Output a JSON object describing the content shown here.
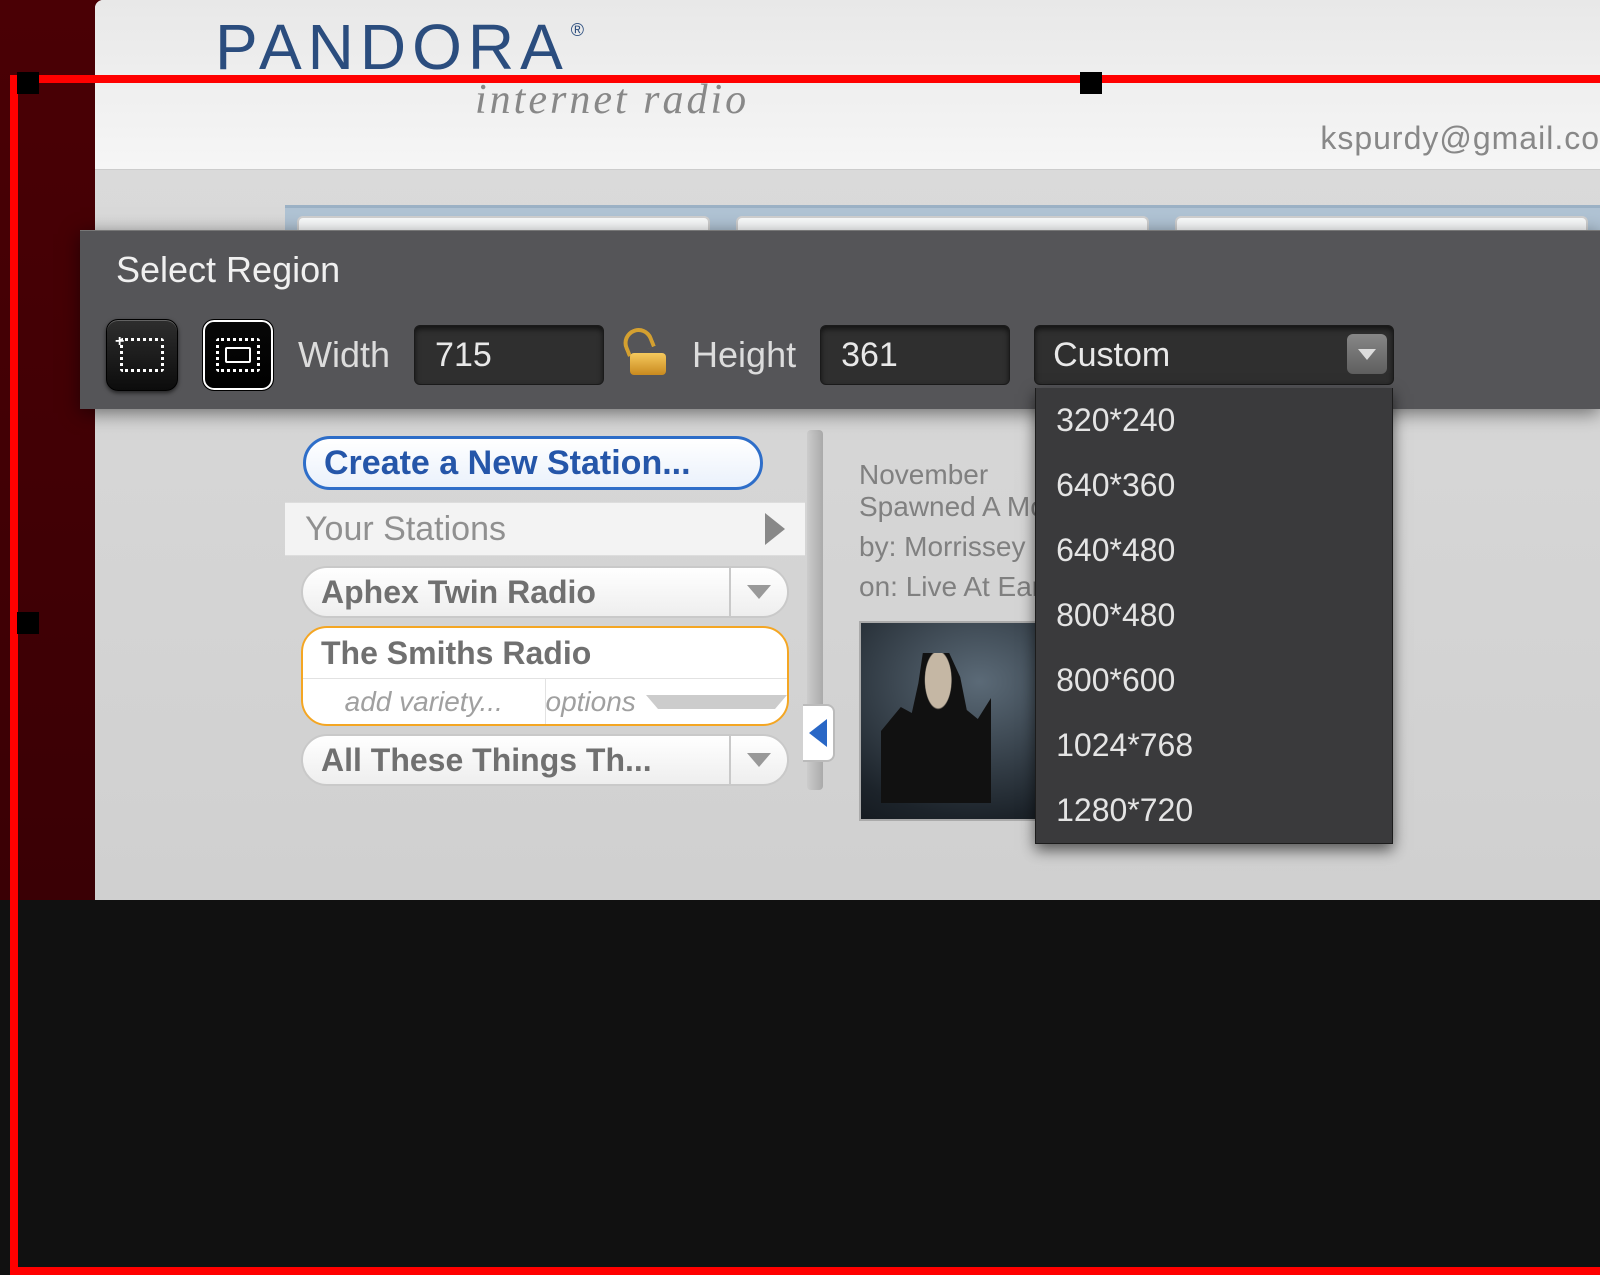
{
  "pandora": {
    "brand": "PANDORA",
    "reg": "®",
    "tagline": "internet radio",
    "user_email": "kspurdy@gmail.co"
  },
  "sidebar": {
    "new_station": "Create a New Station...",
    "your_stations_label": "Your Stations",
    "stations": [
      {
        "name": "Aphex Twin Radio",
        "active": false
      },
      {
        "name": "The Smiths Radio",
        "active": true
      },
      {
        "name": "All These Things Th...",
        "active": false
      }
    ],
    "add_variety": "add variety...",
    "options": "options"
  },
  "now_playing": {
    "title_line": "November\nSpawned A Mons...",
    "by_label": "by:",
    "by_value": "Morrissey",
    "on_label": "on:",
    "on_value": "Live At Earls ..."
  },
  "region_tool": {
    "title": "Select Region",
    "width_label": "Width",
    "width_value": "715",
    "height_label": "Height",
    "height_value": "361",
    "preset_selected": "Custom",
    "presets": [
      "320*240",
      "640*360",
      "640*480",
      "800*480",
      "800*600",
      "1024*768",
      "1280*720"
    ]
  }
}
